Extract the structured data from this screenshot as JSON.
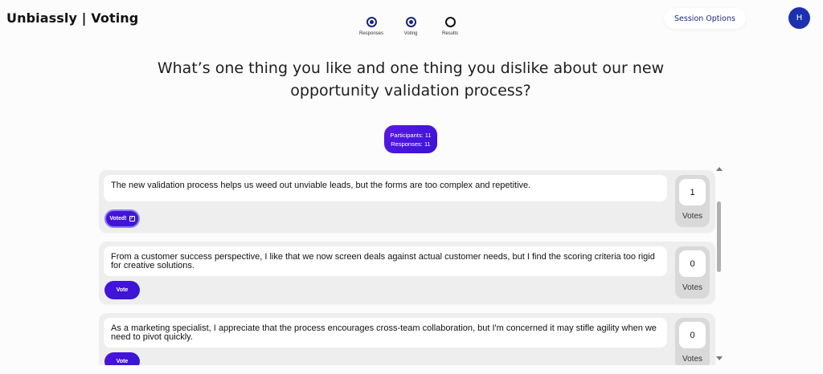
{
  "header": {
    "logo": "Unbiassly | Voting",
    "session_options": "Session Options",
    "avatar_initial": "H"
  },
  "stepper": [
    {
      "label": "Responses",
      "state": "completed"
    },
    {
      "label": "Voting",
      "state": "current"
    },
    {
      "label": "Results",
      "state": "upcoming"
    }
  ],
  "question": "What’s one thing you like and one thing you dislike about our new opportunity validation process?",
  "stats": {
    "participants": "Participants: 11",
    "responses": "Responses: 11"
  },
  "responses": [
    {
      "text": "The new validation process helps us weed out unviable leads, but the forms are too complex and repetitive.",
      "button": "Voted!",
      "voted": true,
      "votes": "1",
      "votes_label": "Votes"
    },
    {
      "text": "From a customer success perspective, I like that we now screen deals against actual customer needs, but I find the scoring criteria too rigid for creative solutions.",
      "button": "Vote",
      "voted": false,
      "votes": "0",
      "votes_label": "Votes"
    },
    {
      "text": "As a marketing specialist, I appreciate that the process encourages cross-team collaboration, but I'm concerned it may stifle agility when we need to pivot quickly.",
      "button": "Vote",
      "voted": false,
      "votes": "0",
      "votes_label": "Votes"
    }
  ],
  "colors": {
    "brand_blue": "#1b31b0",
    "vote_purple": "#4a10e0"
  },
  "icons": {
    "voted_check": "checkbox-check-icon",
    "scroll_up": "triangle-up-icon",
    "scroll_down": "triangle-down-icon"
  }
}
